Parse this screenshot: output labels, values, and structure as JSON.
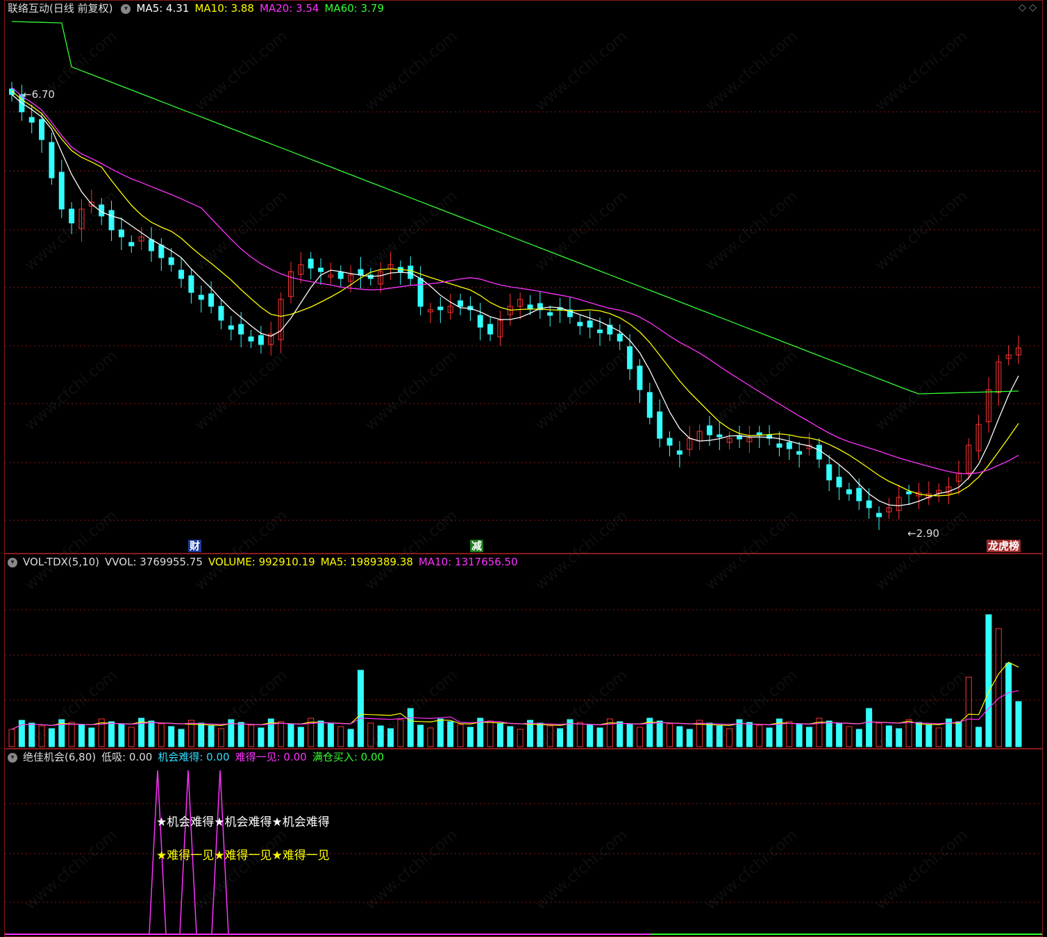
{
  "main": {
    "title": "联络互动(日线 前复权)",
    "ma_labels": [
      {
        "text": "MA5: 4.31",
        "color": "#ffffff"
      },
      {
        "text": "MA10: 3.88",
        "color": "#ffff00"
      },
      {
        "text": "MA20: 3.54",
        "color": "#ff33ff"
      },
      {
        "text": "MA60: 3.79",
        "color": "#33ff33"
      }
    ],
    "high_label": "6.70",
    "low_label": "2.90",
    "markers": [
      {
        "text": "财",
        "color": "#ffffff",
        "bg": "#1a3a9a"
      },
      {
        "text": "减",
        "color": "#ffffff",
        "bg": "#1a7a1a"
      },
      {
        "text": "龙虎榜",
        "color": "#ffffff",
        "bg": "#a02a2a"
      }
    ],
    "corner_icons": "◇ ◇"
  },
  "volume": {
    "title": "VOL-TDX(5,10)",
    "labels": [
      {
        "text": "VVOL: 3769955.75",
        "color": "#dddddd"
      },
      {
        "text": "VOLUME: 992910.19",
        "color": "#ffff00"
      },
      {
        "text": "MA5: 1989389.38",
        "color": "#ffff00"
      },
      {
        "text": "MA10: 1317656.50",
        "color": "#ff33ff"
      }
    ]
  },
  "indicator": {
    "title": "绝佳机会(6,80)",
    "labels": [
      {
        "text": "低吸: 0.00",
        "color": "#dddddd"
      },
      {
        "text": "机会难得: 0.00",
        "color": "#33ddff"
      },
      {
        "text": "难得一见: 0.00",
        "color": "#ff33ff"
      },
      {
        "text": "满仓买入: 0.00",
        "color": "#33ff33"
      }
    ],
    "signal_row1": "★机会难得★机会难得★机会难得",
    "signal_row2": "★难得一见★难得一见★难得一见"
  },
  "watermark": "www.cfchi.com",
  "colors": {
    "up": "#ff3333",
    "down": "#33ffff",
    "grid": "#8b1a1a"
  }
}
